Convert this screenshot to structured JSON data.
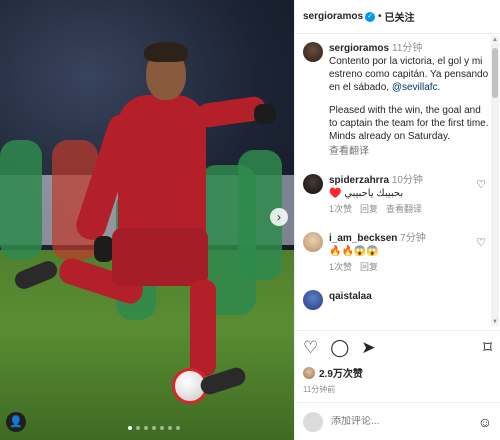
{
  "header": {
    "username": "sergioramos",
    "follow_status": "已关注"
  },
  "caption": {
    "username": "sergioramos",
    "time": "11分钟",
    "text_es": "Contento por la victoria, el gol y mi estreno como capitán. Ya pensando en el sábado, ",
    "mention": "@sevillafc",
    "text_es_end": ".",
    "text_en": "Pleased with the win, the goal and to captain the team for the first time. Minds already on Saturday.",
    "see_translation": "查看翻译"
  },
  "comments": [
    {
      "username": "spiderzahrra",
      "time": "10分钟",
      "text": "♥️ بحبيبك ياحبيبي",
      "likes": "1次赞",
      "reply": "回复",
      "see": "查看翻译"
    },
    {
      "username": "i_am_becksen",
      "time": "7分钟",
      "text": "🔥🔥😱😱",
      "likes": "1次赞",
      "reply": "回复"
    },
    {
      "username": "qaistalaa",
      "time": "",
      "text": ""
    }
  ],
  "actions": {
    "likes_count": "2.9万次赞",
    "post_time": "11分钟前"
  },
  "add_comment": {
    "placeholder": "添加评论..."
  },
  "icons": {
    "like": "heart-icon",
    "comment": "comment-icon",
    "share": "share-icon",
    "save": "bookmark-icon"
  }
}
